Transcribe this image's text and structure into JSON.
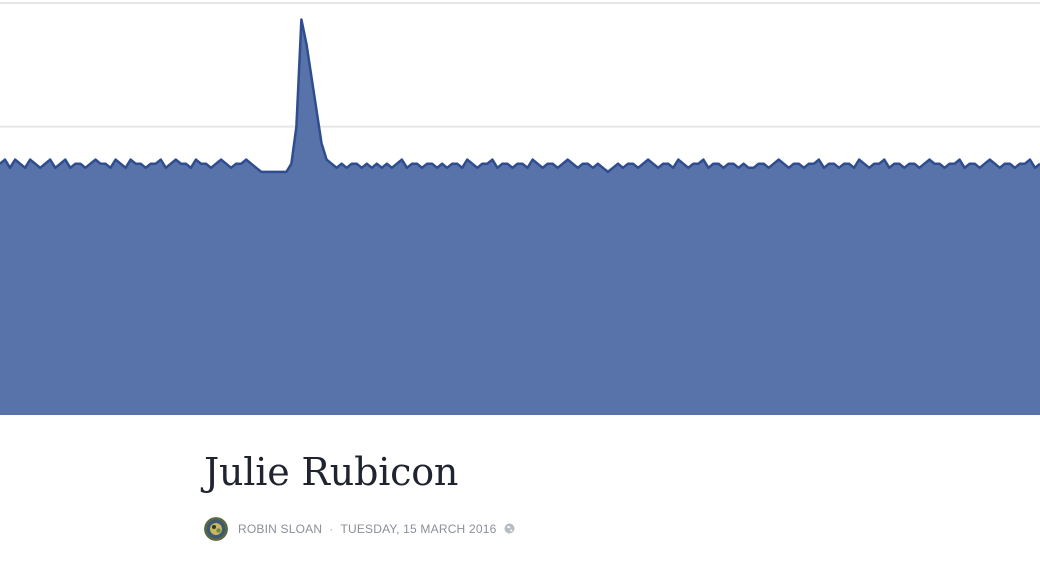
{
  "chart_data": {
    "type": "area",
    "title": "",
    "xlabel": "",
    "ylabel": "",
    "ylim": [
      0,
      100
    ],
    "grid": true,
    "gridlines": [
      100,
      70
    ],
    "series": [
      {
        "values": [
          61,
          62,
          60,
          62,
          61,
          60,
          62,
          61,
          60,
          61,
          62,
          60,
          61,
          62,
          60,
          61,
          61,
          60,
          61,
          62,
          61,
          61,
          60,
          62,
          61,
          60,
          62,
          61,
          61,
          60,
          61,
          61,
          62,
          60,
          61,
          62,
          61,
          61,
          60,
          62,
          61,
          61,
          60,
          61,
          62,
          61,
          60,
          61,
          61,
          62,
          61,
          60,
          59,
          59,
          59,
          59,
          59,
          59,
          61,
          70,
          96,
          90,
          82,
          74,
          66,
          62,
          61,
          60,
          61,
          60,
          61,
          61,
          60,
          61,
          60,
          61,
          60,
          61,
          60,
          61,
          62,
          60,
          61,
          61,
          60,
          61,
          61,
          60,
          61,
          60,
          61,
          61,
          60,
          62,
          61,
          60,
          61,
          61,
          62,
          60,
          61,
          61,
          60,
          61,
          61,
          60,
          62,
          61,
          60,
          61,
          61,
          60,
          61,
          62,
          61,
          60,
          61,
          61,
          60,
          61,
          60,
          59,
          60,
          61,
          60,
          61,
          61,
          60,
          61,
          62,
          61,
          60,
          61,
          61,
          60,
          62,
          61,
          60,
          61,
          61,
          62,
          60,
          61,
          61,
          60,
          61,
          61,
          60,
          61,
          60,
          60,
          61,
          61,
          60,
          61,
          62,
          61,
          60,
          61,
          61,
          60,
          61,
          61,
          62,
          60,
          61,
          61,
          60,
          61,
          61,
          60,
          62,
          61,
          60,
          61,
          61,
          62,
          60,
          61,
          61,
          60,
          61,
          61,
          60,
          61,
          62,
          61,
          61,
          60,
          61,
          61,
          62,
          60,
          61,
          61,
          60,
          61,
          62,
          61,
          60,
          61,
          61,
          60,
          61,
          61,
          62,
          60,
          61
        ]
      }
    ],
    "colors": {
      "fill": "#5872aa",
      "stroke": "#2f4d8f",
      "grid": "#e6e6e6"
    }
  },
  "post": {
    "title": "Julie Rubicon",
    "author": "ROBIN SLOAN",
    "separator": "·",
    "date": "TUESDAY, 15 MARCH 2016",
    "privacy_icon": "globe-icon",
    "avatar_icon": "avatar"
  }
}
